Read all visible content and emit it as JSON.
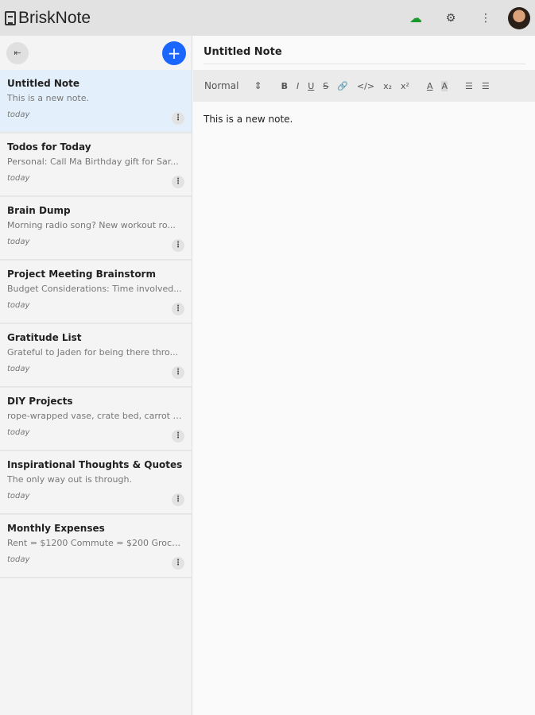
{
  "app": {
    "title": "BriskNote"
  },
  "header": {
    "icons": [
      "cloud-sync-icon",
      "gear-icon",
      "more-vert-icon"
    ]
  },
  "sidebar": {
    "notes": [
      {
        "title": "Untitled Note",
        "preview": "This is a new note.",
        "date": "today"
      },
      {
        "title": "Todos for Today",
        "preview": "Personal: Call Ma Birthday gift for Sar...",
        "date": "today"
      },
      {
        "title": "Brain Dump",
        "preview": "Morning radio song? New workout ro...",
        "date": "today"
      },
      {
        "title": "Project Meeting Brainstorm",
        "preview": "Budget Considerations: Time involved...",
        "date": "today"
      },
      {
        "title": "Gratitude List",
        "preview": "Grateful to Jaden for being there thro...",
        "date": "today"
      },
      {
        "title": "DIY Projects",
        "preview": "rope-wrapped vase, crate bed, carrot j...",
        "date": "today"
      },
      {
        "title": "Inspirational Thoughts & Quotes",
        "preview": "The only way out is through.",
        "date": "today"
      },
      {
        "title": "Monthly Expenses",
        "preview": "Rent = $1200 Commute = $200 Groce...",
        "date": "today"
      }
    ]
  },
  "editor": {
    "title": "Untitled Note",
    "format": "Normal",
    "body": "This is a new note.",
    "tools": {
      "bold": "B",
      "italic": "I",
      "underline": "U",
      "strike": "S",
      "link": "🔗",
      "code": "</>",
      "sub": "x₂",
      "sup": "x²",
      "color": "A",
      "bg": "A",
      "ol": "☰",
      "ul": "☰"
    }
  }
}
